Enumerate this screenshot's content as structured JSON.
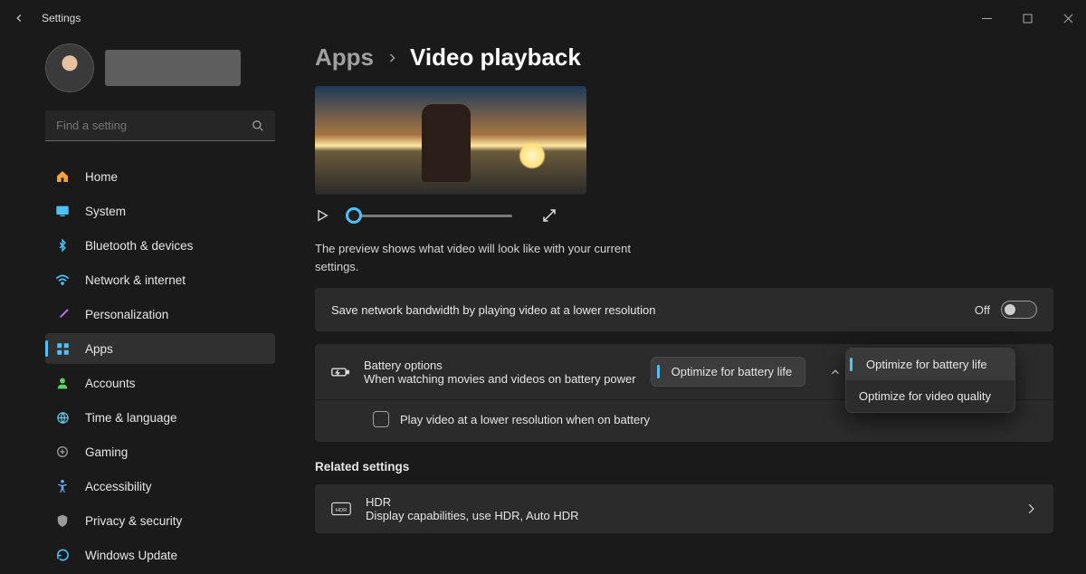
{
  "window": {
    "title": "Settings"
  },
  "search": {
    "placeholder": "Find a setting"
  },
  "sidebar": {
    "items": [
      {
        "label": "Home",
        "icon": "home-icon",
        "color": "#f2a23a"
      },
      {
        "label": "System",
        "icon": "system-icon",
        "color": "#4cc2ff"
      },
      {
        "label": "Bluetooth & devices",
        "icon": "bluetooth-icon",
        "color": "#4cc2ff"
      },
      {
        "label": "Network & internet",
        "icon": "wifi-icon",
        "color": "#4cc2ff"
      },
      {
        "label": "Personalization",
        "icon": "brush-icon",
        "color": "#c77dff"
      },
      {
        "label": "Apps",
        "icon": "apps-icon",
        "color": "#4cc2ff"
      },
      {
        "label": "Accounts",
        "icon": "person-icon",
        "color": "#5fd068"
      },
      {
        "label": "Time & language",
        "icon": "globe-icon",
        "color": "#63c7e0"
      },
      {
        "label": "Gaming",
        "icon": "gaming-icon",
        "color": "#9a9a9a"
      },
      {
        "label": "Accessibility",
        "icon": "accessibility-icon",
        "color": "#6bb2ff"
      },
      {
        "label": "Privacy & security",
        "icon": "shield-icon",
        "color": "#9a9a9a"
      },
      {
        "label": "Windows Update",
        "icon": "update-icon",
        "color": "#4cc2ff"
      }
    ],
    "active_index": 5
  },
  "breadcrumb": {
    "parent": "Apps",
    "page": "Video playback"
  },
  "preview": {
    "description": "The preview shows what video will look like with your current settings."
  },
  "settings": {
    "bandwidth": {
      "label": "Save network bandwidth by playing video at a lower resolution",
      "state": "Off"
    },
    "battery": {
      "title": "Battery options",
      "subtitle": "When watching movies and videos on battery power",
      "selected_option": "Optimize for battery life",
      "options": [
        "Optimize for battery life",
        "Optimize for video quality"
      ],
      "sub_checkbox_label": "Play video at a lower resolution when on battery"
    }
  },
  "related": {
    "heading": "Related settings",
    "hdr": {
      "title": "HDR",
      "subtitle": "Display capabilities, use HDR, Auto HDR"
    }
  }
}
